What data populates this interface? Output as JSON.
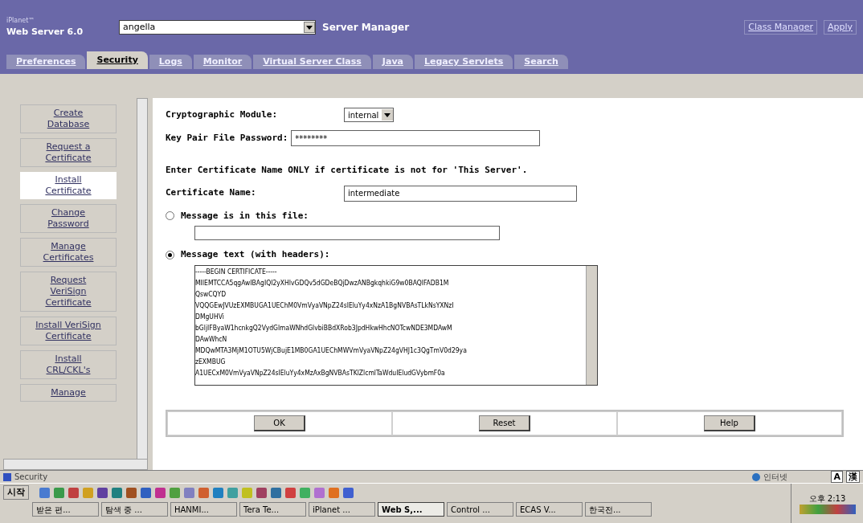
{
  "header": {
    "brand_top": "iPlanet™",
    "brand": "Web Server 6.0",
    "server_select": "angella",
    "title": "Server Manager",
    "links": [
      "Class Manager",
      "Apply"
    ]
  },
  "tabs": [
    {
      "label": "Preferences",
      "selected": false
    },
    {
      "label": "Security",
      "selected": true
    },
    {
      "label": "Logs",
      "selected": false
    },
    {
      "label": "Monitor",
      "selected": false
    },
    {
      "label": "Virtual Server Class",
      "selected": false
    },
    {
      "label": "Java",
      "selected": false
    },
    {
      "label": "Legacy Servlets",
      "selected": false
    },
    {
      "label": "Search",
      "selected": false
    }
  ],
  "sidebar": {
    "items": [
      {
        "label": "Create Database",
        "selected": false
      },
      {
        "label": "Request a Certificate",
        "selected": false
      },
      {
        "label": "Install Certificate",
        "selected": true
      },
      {
        "label": "Change Password",
        "selected": false
      },
      {
        "label": "Manage Certificates",
        "selected": false
      },
      {
        "label": "Request VeriSign Certificate",
        "selected": false
      },
      {
        "label": "Install VeriSign Certificate",
        "selected": false
      },
      {
        "label": "Install CRL/CKL's",
        "selected": false
      },
      {
        "label": "Manage",
        "selected": false
      }
    ]
  },
  "form": {
    "module_label": "Cryptographic Module:",
    "module_value": "internal",
    "password_label": "Key Pair File Password:",
    "password_value": "********",
    "note": "Enter Certificate Name ONLY if certificate is not for 'This Server'.",
    "name_label": "Certificate Name:",
    "name_value": "intermediate",
    "options": [
      {
        "label": "Message is in this file:",
        "selected": false,
        "kind": "file"
      },
      {
        "label": "Message text (with headers):",
        "selected": true,
        "kind": "text"
      }
    ],
    "message_lines": [
      "-----BEGIN CERTIFICATE-----",
      "MIIEMTCCA5qgAwIBAgIQI2yXHIvGDQv5dGDeBQjDwzANBgkqhkiG9w0BAQIFADB1M",
      "QswCQYD",
      "VQQGEwJVUzEXMBUGA1UEChM0VmVyaVNpZ24sIEluYy4xNzA1BgNVBAsTLkNsYXNzI",
      "DMgUHVi",
      "bGljIFByaW1hcnkgQ2VydGlmaWNhdGlvbiBBdXRob3JpdHkwHhcNOTcwNDE3MDAwM",
      "DAwWhcN",
      "MDQwMTA3MjM1OTU5WjCBujE1MB0GA1UEChMWVmVyaVNpZ24gVHJ1c3QgTmV0d29ya",
      "zEXMBUG",
      "A1UECxM0VmVyaVNpZ24sIEluYy4xMzAxBgNVBAsTKlZlcmlTaWduIEludGVybmF0a"
    ],
    "buttons": [
      "OK",
      "Reset",
      "Help"
    ]
  },
  "status_bar": {
    "text": "Security",
    "zone": "인터넷",
    "ime": [
      "A",
      "漢"
    ]
  },
  "taskbar": {
    "start": "시작",
    "tasks": [
      {
        "label": "받은 편...",
        "selected": false
      },
      {
        "label": "탐색 중 ...",
        "selected": false
      },
      {
        "label": "HANMI...",
        "selected": false
      },
      {
        "label": "Tera Te...",
        "selected": false
      },
      {
        "label": "iPlanet ...",
        "selected": false
      },
      {
        "label": "Web S,...",
        "selected": true
      },
      {
        "label": "Control ...",
        "selected": false
      },
      {
        "label": "ECAS V...",
        "selected": false
      },
      {
        "label": "한국전...",
        "selected": false
      }
    ],
    "time": "오후 2:13"
  }
}
